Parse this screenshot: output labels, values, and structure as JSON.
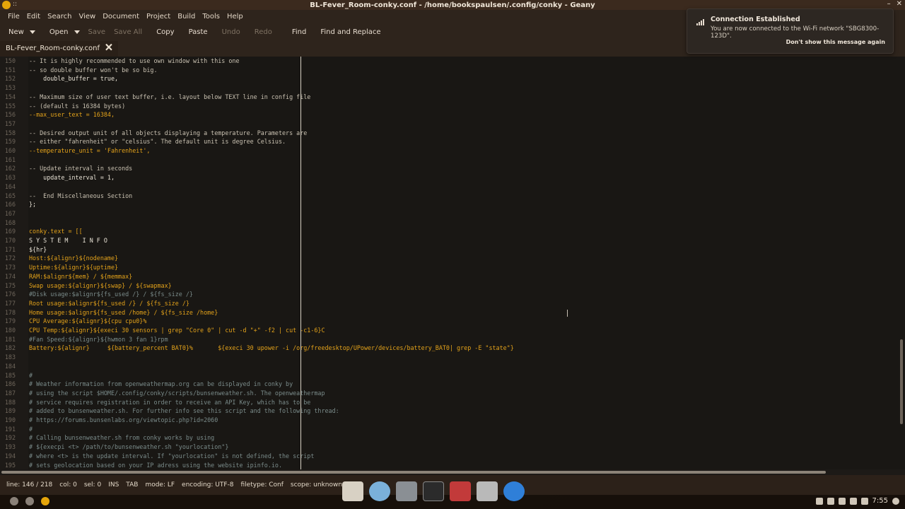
{
  "window": {
    "title": "BL-Fever_Room-conky.conf - /home/bookspaulsen/.config/conky - Geany",
    "wm_menu": "::"
  },
  "menubar": [
    "File",
    "Edit",
    "Search",
    "View",
    "Document",
    "Project",
    "Build",
    "Tools",
    "Help"
  ],
  "toolbar": {
    "new": "New",
    "open": "Open",
    "save": "Save",
    "save_all": "Save All",
    "copy": "Copy",
    "paste": "Paste",
    "undo": "Undo",
    "redo": "Redo",
    "find": "Find",
    "find_replace": "Find and Replace"
  },
  "tab": {
    "label": "BL-Fever_Room-conky.conf",
    "close": "🗙"
  },
  "editor": {
    "lines": [
      {
        "n": "150",
        "text": "-- It is highly recommended to use own window with this one",
        "cls": "c-comment"
      },
      {
        "n": "151",
        "text": "-- so double buffer won't be so big.",
        "cls": "c-comment"
      },
      {
        "n": "152",
        "text": "    double_buffer = true,",
        "cls": "c-plain"
      },
      {
        "n": "153",
        "text": "",
        "cls": "c-plain"
      },
      {
        "n": "154",
        "text": "-- Maximum size of user text buffer, i.e. layout below TEXT line in config file",
        "cls": "c-comment"
      },
      {
        "n": "155",
        "text": "-- (default is 16384 bytes)",
        "cls": "c-comment"
      },
      {
        "n": "156",
        "text": "--max_user_text = 16384,",
        "cls": "c-key"
      },
      {
        "n": "157",
        "text": "",
        "cls": "c-plain"
      },
      {
        "n": "158",
        "text": "-- Desired output unit of all objects displaying a temperature. Parameters are",
        "cls": "c-comment"
      },
      {
        "n": "159",
        "text": "-- either \"fahrenheit\" or \"celsius\". The default unit is degree Celsius.",
        "cls": "c-comment"
      },
      {
        "n": "160",
        "text": "--temperature_unit = 'Fahrenheit',",
        "cls": "c-key"
      },
      {
        "n": "161",
        "text": "",
        "cls": "c-plain"
      },
      {
        "n": "162",
        "text": "-- Update interval in seconds",
        "cls": "c-comment"
      },
      {
        "n": "163",
        "text": "    update_interval = 1,",
        "cls": "c-plain"
      },
      {
        "n": "164",
        "text": "",
        "cls": "c-plain"
      },
      {
        "n": "165",
        "text": "--  End Miscellaneous Section",
        "cls": "c-comment"
      },
      {
        "n": "166",
        "text": "};",
        "cls": "c-plain"
      },
      {
        "n": "167",
        "text": "",
        "cls": "c-plain"
      },
      {
        "n": "168",
        "text": "",
        "cls": "c-plain"
      },
      {
        "n": "169",
        "text": "conky.text = [[",
        "cls": "c-key"
      },
      {
        "n": "170",
        "text": "S Y S T E M    I N F O",
        "cls": "c-plain"
      },
      {
        "n": "171",
        "text": "${hr}",
        "cls": "c-plain"
      },
      {
        "n": "172",
        "text": "Host:${alignr}${nodename}",
        "cls": "c-key"
      },
      {
        "n": "173",
        "text": "Uptime:${alignr}${uptime}",
        "cls": "c-key"
      },
      {
        "n": "174",
        "text": "RAM:$alignr${mem} / ${memmax}",
        "cls": "c-key"
      },
      {
        "n": "175",
        "text": "Swap usage:${alignr}${swap} / ${swapmax}",
        "cls": "c-key"
      },
      {
        "n": "176",
        "text": "#Disk usage:$alignr${fs_used /} / ${fs_size /}",
        "cls": "c-dim"
      },
      {
        "n": "177",
        "text": "Root usage:$alignr${fs_used /} / ${fs_size /}",
        "cls": "c-key"
      },
      {
        "n": "178",
        "text": "Home usage:$alignr${fs_used /home} / ${fs_size /home}",
        "cls": "c-key"
      },
      {
        "n": "179",
        "text": "CPU Average:${alignr}${cpu cpu0}%",
        "cls": "c-key"
      },
      {
        "n": "180",
        "text": "CPU Temp:${alignr}${execi 30 sensors | grep \"Core 0\" | cut -d \"+\" -f2 | cut -c1-6}C",
        "cls": "c-key"
      },
      {
        "n": "181",
        "text": "#Fan Speed:${alignr}${hwmon 3 fan 1}rpm",
        "cls": "c-dim"
      },
      {
        "n": "182",
        "text": "Battery:${alignr}     ${battery_percent BAT0}%       ${execi 30 upower -i /org/freedesktop/UPower/devices/battery_BAT0| grep -E \"state\"}",
        "cls": "c-key"
      },
      {
        "n": "183",
        "text": "",
        "cls": "c-plain"
      },
      {
        "n": "184",
        "text": "",
        "cls": "c-plain"
      },
      {
        "n": "185",
        "text": "#",
        "cls": "c-dim"
      },
      {
        "n": "186",
        "text": "# Weather information from openweathermap.org can be displayed in conky by",
        "cls": "c-dim"
      },
      {
        "n": "187",
        "text": "# using the script $HOME/.config/conky/scripts/bunsenweather.sh. The openweathermap",
        "cls": "c-dim"
      },
      {
        "n": "188",
        "text": "# service requires registration in order to receive an API Key, which has to be",
        "cls": "c-dim"
      },
      {
        "n": "189",
        "text": "# added to bunsenweather.sh. For further info see this script and the following thread:",
        "cls": "c-dim"
      },
      {
        "n": "190",
        "text": "# https://forums.bunsenlabs.org/viewtopic.php?id=2060",
        "cls": "c-dim"
      },
      {
        "n": "191",
        "text": "#",
        "cls": "c-dim"
      },
      {
        "n": "192",
        "text": "# Calling bunsenweather.sh from conky works by using",
        "cls": "c-dim"
      },
      {
        "n": "193",
        "text": "# ${execpi <t> /path/to/bunsenweather.sh \"yourlocation\"}",
        "cls": "c-dim"
      },
      {
        "n": "194",
        "text": "# where <t> is the update interval. If \"yourlocation\" is not defined, the script",
        "cls": "c-dim"
      },
      {
        "n": "195",
        "text": "# sets geolocation based on your IP adress using the website ipinfo.io.",
        "cls": "c-dim"
      }
    ]
  },
  "statusbar": {
    "line": "line: 146 / 218",
    "col": "col: 0",
    "sel": "sel: 0",
    "ins": "INS",
    "tab": "TAB",
    "mode": "mode: LF",
    "encoding": "encoding: UTF-8",
    "filetype": "filetype: Conf",
    "scope": "scope: unknown"
  },
  "notification": {
    "title": "Connection Established",
    "body": "You are now connected to the Wi-Fi network \"SBG8300-123D\".",
    "action": "Don't show this message again"
  },
  "clock": "7:55",
  "colors": {
    "comment": "#c9c1b1",
    "keyword": "#e3a21a",
    "dim_comment": "#7a8b8a",
    "editor_bg": "#191714"
  }
}
